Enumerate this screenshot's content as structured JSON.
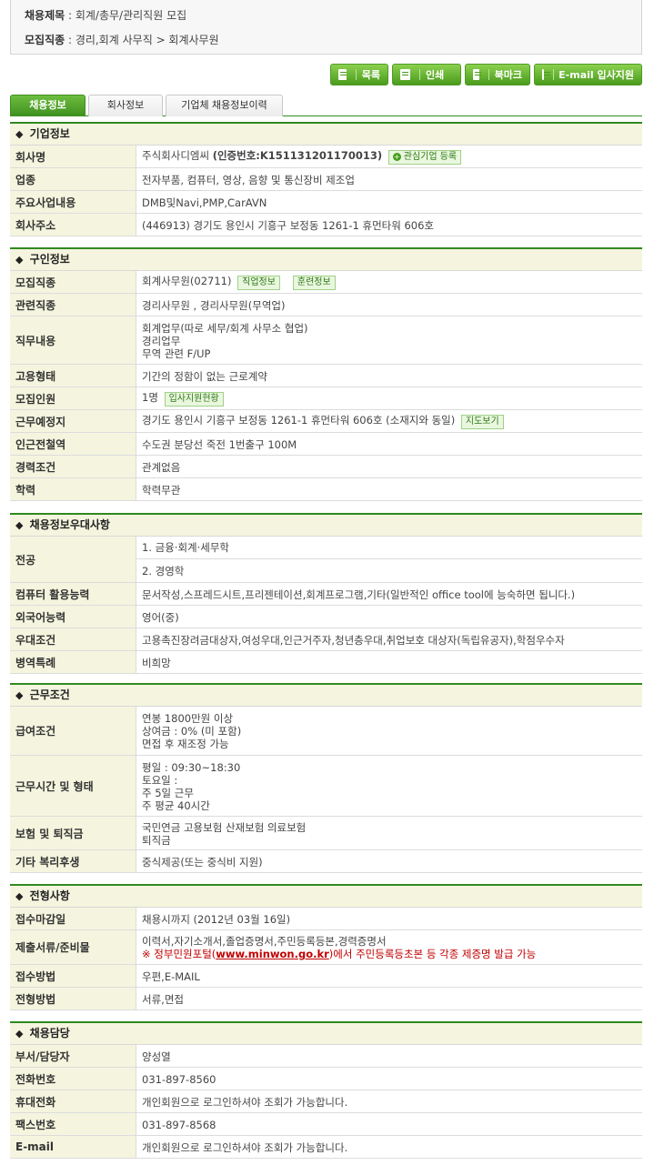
{
  "summary": {
    "title_label": "채용제목",
    "title_value": "회계/총무/관리직원 모집",
    "job_label": "모집직종",
    "job_value": "경리,회계 사무직 > 회계사무원"
  },
  "actions": {
    "list": "목록",
    "print": "인쇄",
    "bookmark": "북마크",
    "email_apply": "E-mail 입사지원"
  },
  "tabs": [
    {
      "label": "채용정보"
    },
    {
      "label": "회사정보"
    },
    {
      "label": "기업체 채용정보이력"
    }
  ],
  "company": {
    "header": "기업정보",
    "name_label": "회사명",
    "name_value": "주식회사디엠씨",
    "cert": "(인증번호:K151131201170013)",
    "fav_button": "관심기업 등록",
    "industry_label": "업종",
    "industry_value": "전자부품, 컴퓨터, 영상, 음향 및 통신장비 제조업",
    "business_label": "주요사업내용",
    "business_value": "DMB및Navi,PMP,CarAVN",
    "address_label": "회사주소",
    "address_value": "(446913) 경기도 용인시 기흥구 보정동 1261-1 휴먼타워 606호"
  },
  "job": {
    "header": "구인정보",
    "type_label": "모집직종",
    "type_value": "회계사무원(02711)",
    "type_tag1": "직업정보",
    "type_tag2": "훈련정보",
    "related_label": "관련직종",
    "related_value": "경리사무원 , 경리사무원(무역업)",
    "duty_label": "직무내용",
    "duty_lines": [
      "회계업무(따로 세무/회계 사무소 협업)",
      "경리업무",
      "무역 관련 F/UP"
    ],
    "employ_label": "고용형태",
    "employ_value": "기간의 정함이 없는 근로계약",
    "count_label": "모집인원",
    "count_value": "1명",
    "count_tag": "입사지원현황",
    "place_label": "근무예정지",
    "place_value": "경기도 용인시 기흥구 보정동 1261-1 휴먼타워 606호 (소재지와 동일)",
    "place_tag": "지도보기",
    "subway_label": "인근전철역",
    "subway_value": "수도권 분당선 죽전 1번출구 100M",
    "career_label": "경력조건",
    "career_value": "관계없음",
    "edu_label": "학력",
    "edu_value": "학력무관"
  },
  "prefer": {
    "header": "채용정보우대사항",
    "major_label": "전공",
    "major_values": [
      "1. 금융·회계·세무학",
      "2. 경영학"
    ],
    "computer_label": "컴퓨터 활용능력",
    "computer_value": "문서작성,스프레드시트,프리젠테이션,회계프로그램,기타(일반적인 office tool에 능숙하면 됩니다.)",
    "lang_label": "외국어능력",
    "lang_value": "영어(중)",
    "cond_label": "우대조건",
    "cond_value": "고용촉진장려금대상자,여성우대,인근거주자,청년층우대,취업보호 대상자(독립유공자),학점우수자",
    "military_label": "병역특례",
    "military_value": "비희망"
  },
  "work": {
    "header": "근무조건",
    "salary_label": "급여조건",
    "salary_lines": [
      "연봉 1800만원 이상",
      "상여금 : 0% (미 포함)",
      "면접 후 재조정 가능"
    ],
    "hours_label": "근무시간 및 형태",
    "hours_lines": [
      "평일 : 09:30~18:30",
      "토요일 :",
      "주 5일 근무",
      "주 평균 40시간"
    ],
    "insure_label": "보험 및 퇴직금",
    "insure_lines": [
      "국민연금 고용보험 산재보험 의료보험",
      "퇴직금"
    ],
    "welfare_label": "기타 복리후생",
    "welfare_value": "중식제공(또는 중식비 지원)"
  },
  "process": {
    "header": "전형사항",
    "deadline_label": "접수마감일",
    "deadline_value": "채용시까지 (2012년 03월 16일)",
    "docs_label": "제출서류/준비물",
    "docs_value": "이력서,자기소개서,졸업증명서,주민등록등본,경력증명서",
    "docs_warn_pre": "※ 정부민원포털(",
    "docs_warn_link": "www.minwon.go.kr",
    "docs_warn_post": ")에서 주민등록등초본 등 각종 제증명 발급 가능",
    "method_label": "접수방법",
    "method_value": "우편,E-MAIL",
    "select_label": "전형방법",
    "select_value": "서류,면접"
  },
  "contact": {
    "header": "채용담당",
    "person_label": "부서/담당자",
    "person_value": "양성열",
    "phone_label": "전화번호",
    "phone_value": "031-897-8560",
    "mobile_label": "휴대전화",
    "mobile_value": "개인회원으로 로그인하셔야 조회가 가능합니다.",
    "fax_label": "팩스번호",
    "fax_value": "031-897-8568",
    "email_label": "E-mail",
    "email_value": "개인회원으로 로그인하셔야 조회가 가능합니다."
  }
}
